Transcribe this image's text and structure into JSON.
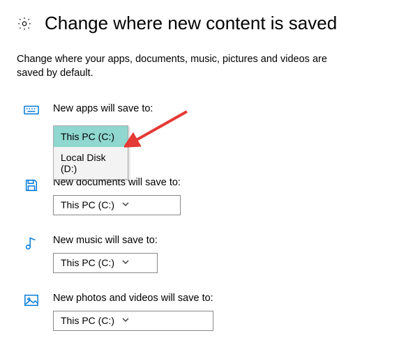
{
  "title": "Change where new content is saved",
  "subtitle": "Change where your apps, documents, music, pictures and videos are saved by default.",
  "sections": {
    "apps": {
      "label": "New apps will save to:",
      "value": "This PC (C:)"
    },
    "documents": {
      "label": "New documents will save to:",
      "value": "This PC (C:)"
    },
    "music": {
      "label": "New music will save to:",
      "value": "This PC (C:)"
    },
    "photos": {
      "label": "New photos and videos will save to:",
      "value": "This PC (C:)"
    }
  },
  "dropdown_options": [
    "This PC (C:)",
    "Local Disk (D:)"
  ],
  "dropdown_selected_index": 0,
  "colors": {
    "accent": "#0078d7",
    "highlight": "#8fd7cf",
    "arrow": "#e53935"
  }
}
